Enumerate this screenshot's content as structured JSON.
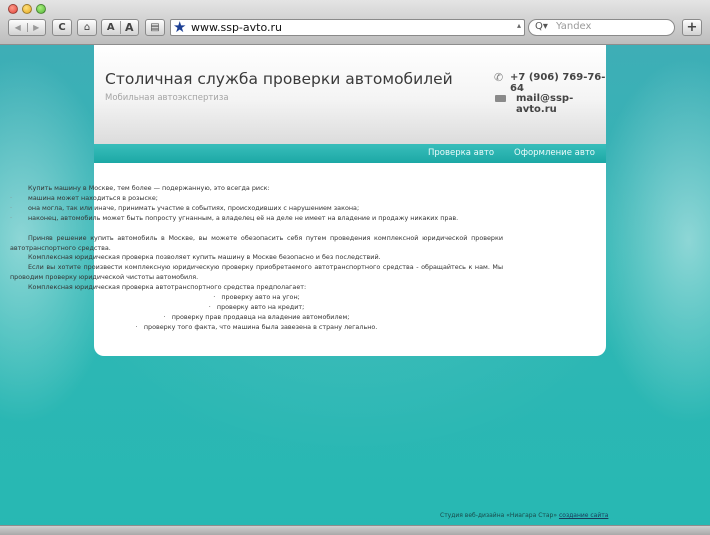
{
  "browser": {
    "url": "www.ssp-avto.ru",
    "search_placeholder": "Yandex",
    "icons": {
      "back": "◀",
      "forward": "▶",
      "reload": "C",
      "home": "⌂",
      "font_small": "A",
      "font_large": "A",
      "print": "▤",
      "bookmark": "★",
      "url_menu": "▴",
      "search": "Q▾",
      "add_tab": "+"
    }
  },
  "header": {
    "title": "Столичная служба проверки автомобилей",
    "subtitle": "Мобильная автоэкспертиза",
    "phone": "+7 (906) 769-76-64",
    "email": "mail@ssp-avto.ru",
    "phone_icon": "✆"
  },
  "nav": {
    "items": [
      {
        "label": "Проверка авто"
      },
      {
        "label": "Оформление авто"
      }
    ]
  },
  "content": {
    "intro": "Купить машину в Москве, тем более — подержанную, это всегда риск:",
    "bullet_marker": "·",
    "risks": [
      "машина может находиться в розыске;",
      "она могла, так или иначе, принимать участие в событиях, происходивших с нарушением закона;",
      "наконец, автомобиль может быть попросту угнанным, а владелец её на деле не имеет на владение и продажу никаких прав."
    ],
    "paragraphs": [
      "Приняв решение купить автомобиль в Москве, вы можете обезопасить себя путем проведения комплексной юридической проверки автотранспортного средства.",
      "Комплексная юридическая проверка позволяет купить машину в Москве безопасно и без последствий.",
      "Если вы хотите произвести комплексную юридическую проверку приобретаемого автотранспортного средства - обращайтесь к нам. Мы проводим проверку юридической чистоты автомобиля.",
      "Комплексная юридическая проверка автотранспортного средства предполагает:"
    ],
    "checks": [
      "проверку авто на угон;",
      "проверку авто на кредит;",
      "проверку прав продавца на владение автомобилем;",
      "проверку того факта, что машина была завезена в страну легально."
    ]
  },
  "footer": {
    "text": "Студия веб-дизайна «Ниагара Стар»",
    "link": "создание сайта"
  }
}
